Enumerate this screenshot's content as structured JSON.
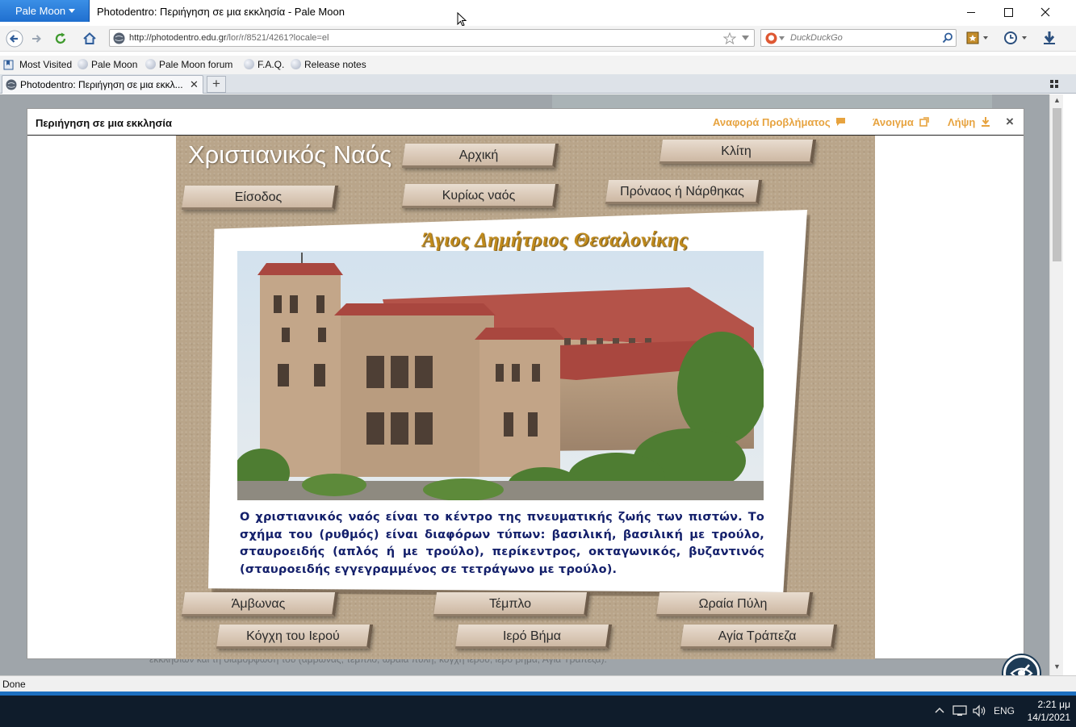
{
  "window": {
    "app_button": "Pale Moon",
    "title": "Photodentro: Περιήγηση σε μια εκκλησία - Pale Moon"
  },
  "nav": {
    "url_domain": "http://photodentro.edu.gr",
    "url_path": "/lor/r/8521/4261?locale=el",
    "search_placeholder": "DuckDuckGo"
  },
  "bookmarks": [
    "Most Visited",
    "Pale Moon",
    "Pale Moon forum",
    "F.A.Q.",
    "Release notes"
  ],
  "tab": {
    "label": "Photodentro: Περιήγηση σε μια εκκλ..."
  },
  "background_snippet": "εκκλησιών και τη διαμόρφωσή του (άμβωνας, τέμπλο, ωραία πύλη, κόγχη ιερού, ιερό βήμα, Αγία Τράπεζα).",
  "modal": {
    "title": "Περιήγηση σε μια εκκλησία",
    "report_label": "Αναφορά Προβλήματος",
    "open_label": "Άνοιγμα",
    "download_label": "Λήψη",
    "close_glyph": "×"
  },
  "content": {
    "main_title": "Χριστιανικός Ναός",
    "church_title": "Άγιος Δημήτριος Θεσαλονίκης",
    "description": "Ο χριστιανικός ναός είναι το κέντρο της πνευματικής ζωής των πιστών. Το σχήμα του (ρυθμός) είναι διαφόρων τύπων: βασιλική, βασιλική με τρούλο, σταυροειδής (απλός ή με τρούλο), περίκεντρος, οκταγωνικός, βυζαντινός (σταυροειδής εγγεγραμμένος σε τετράγωνο με τρούλο).",
    "buttons": {
      "home": "Αρχική",
      "klites": "Κλίτη",
      "entrance": "Είσοδος",
      "main_nave": "Κυρίως ναός",
      "narthex": "Πρόναος ή Νάρθηκας",
      "ambo": "Άμβωνας",
      "templon": "Τέμπλο",
      "beautiful_gate": "Ωραία Πύλη",
      "apse": "Κόγχη του Ιερού",
      "sanctuary": "Ιερό Βήμα",
      "altar": "Αγία Τράπεζα"
    }
  },
  "status": {
    "text": "Done"
  },
  "taskbar": {
    "language": "ENG",
    "time": "2:21 μμ",
    "date": "14/1/2021"
  },
  "colors": {
    "accent": "#1f6fcf",
    "modal_link": "#e7a33f",
    "description_text": "#14206b",
    "church_title": "#c08a1b"
  }
}
